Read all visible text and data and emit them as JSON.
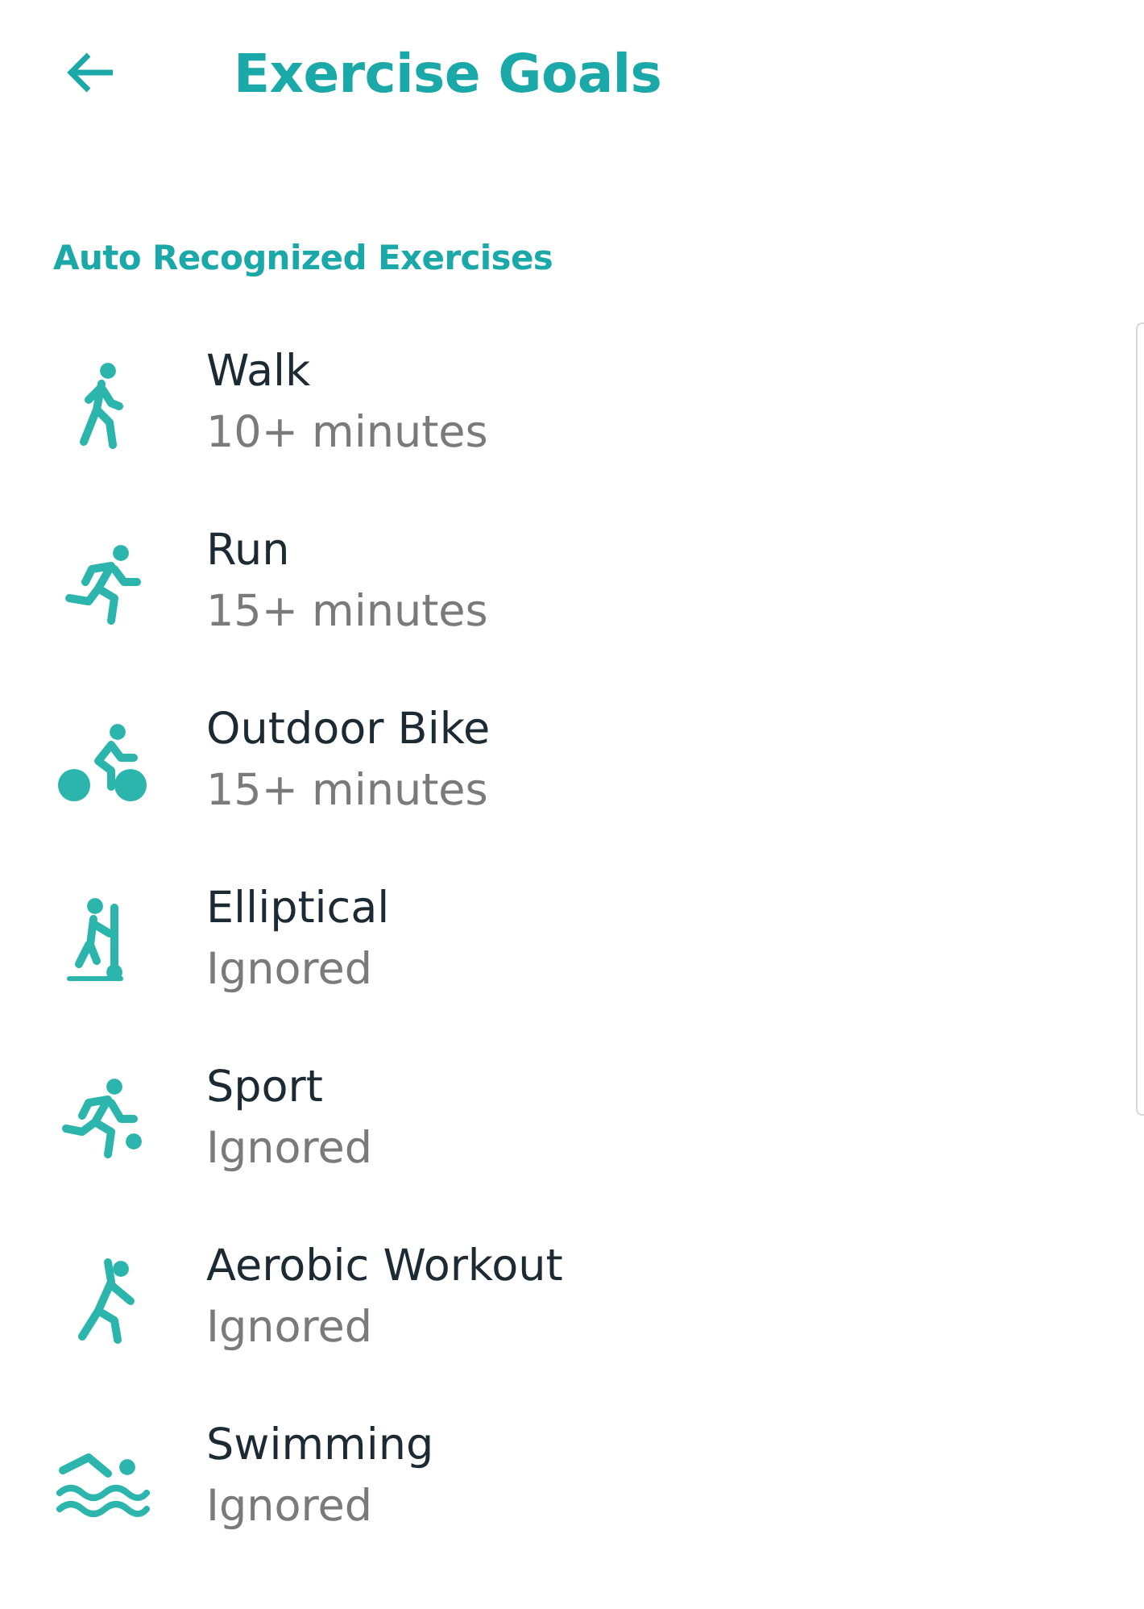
{
  "header": {
    "title": "Exercise Goals"
  },
  "section": {
    "title": "Auto Recognized Exercises"
  },
  "exercises": [
    {
      "kind": "walk",
      "name": "Walk",
      "goal": "10+ minutes"
    },
    {
      "kind": "run",
      "name": "Run",
      "goal": "15+ minutes"
    },
    {
      "kind": "bike",
      "name": "Outdoor Bike",
      "goal": "15+ minutes"
    },
    {
      "kind": "elliptical",
      "name": "Elliptical",
      "goal": "Ignored"
    },
    {
      "kind": "sport",
      "name": "Sport",
      "goal": "Ignored"
    },
    {
      "kind": "aerobic",
      "name": "Aerobic Workout",
      "goal": "Ignored"
    },
    {
      "kind": "swim",
      "name": "Swimming",
      "goal": "Ignored"
    }
  ]
}
